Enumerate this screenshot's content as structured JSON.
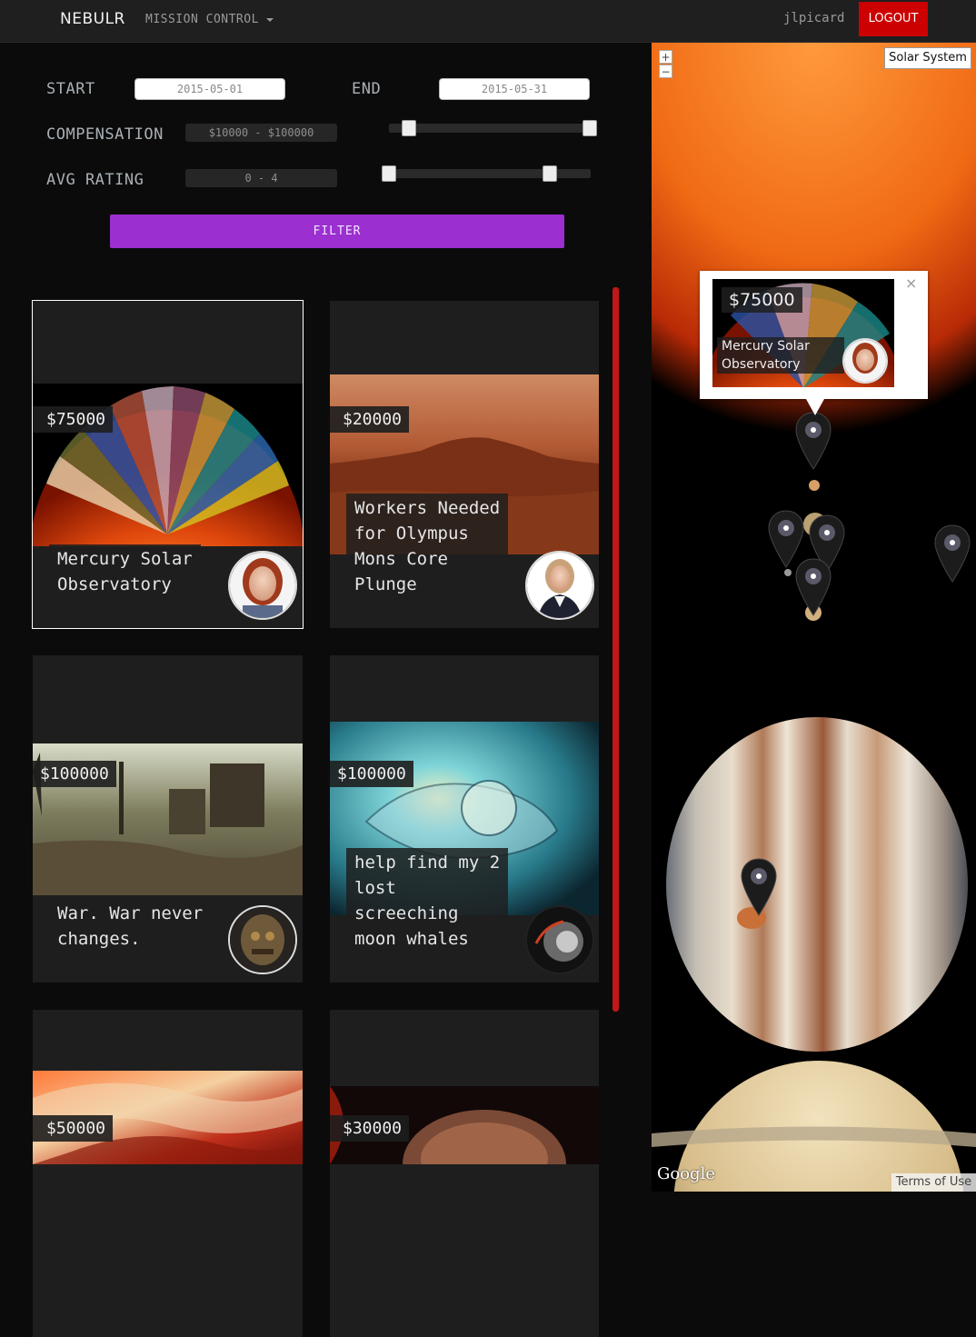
{
  "nav": {
    "brand": "NEBULR",
    "menu_label": "MISSION CONTROL",
    "username": "jlpicard",
    "logout_label": "LOGOUT"
  },
  "filters": {
    "start_label": "START",
    "start_value": "2015-05-01",
    "end_label": "END",
    "end_value": "2015-05-31",
    "compensation_label": "COMPENSATION",
    "compensation_range": "$10000 - $100000",
    "rating_label": "AVG RATING",
    "rating_range": "0 - 4",
    "filter_label": "FILTER"
  },
  "cards": [
    {
      "price": "$75000",
      "title": "Mercury Solar\nObservatory"
    },
    {
      "price": "$20000",
      "title": "Workers Needed\nfor Olympus\nMons Core\nPlunge"
    },
    {
      "price": "$100000",
      "title": "War. War never\nchanges."
    },
    {
      "price": "$100000",
      "title": "help find my 2\nlost\nscreeching\nmoon whales"
    },
    {
      "price": "$50000",
      "title": ""
    },
    {
      "price": "$30000",
      "title": ""
    }
  ],
  "map": {
    "zoom_in": "+",
    "zoom_out": "−",
    "map_type_label": "Solar System",
    "info_window": {
      "close": "×",
      "price": "$75000",
      "title": "Mercury Solar\nObservatory"
    },
    "attribution": "Google",
    "terms": "Terms of Use"
  },
  "icons": {
    "pin": "galaxy-map-pin-icon",
    "close": "close-icon",
    "caret": "caret-down-icon"
  },
  "colors": {
    "accent_purple": "#9b2fcf",
    "logout_red": "#cc0000",
    "scrollbar_red": "#c01818"
  }
}
